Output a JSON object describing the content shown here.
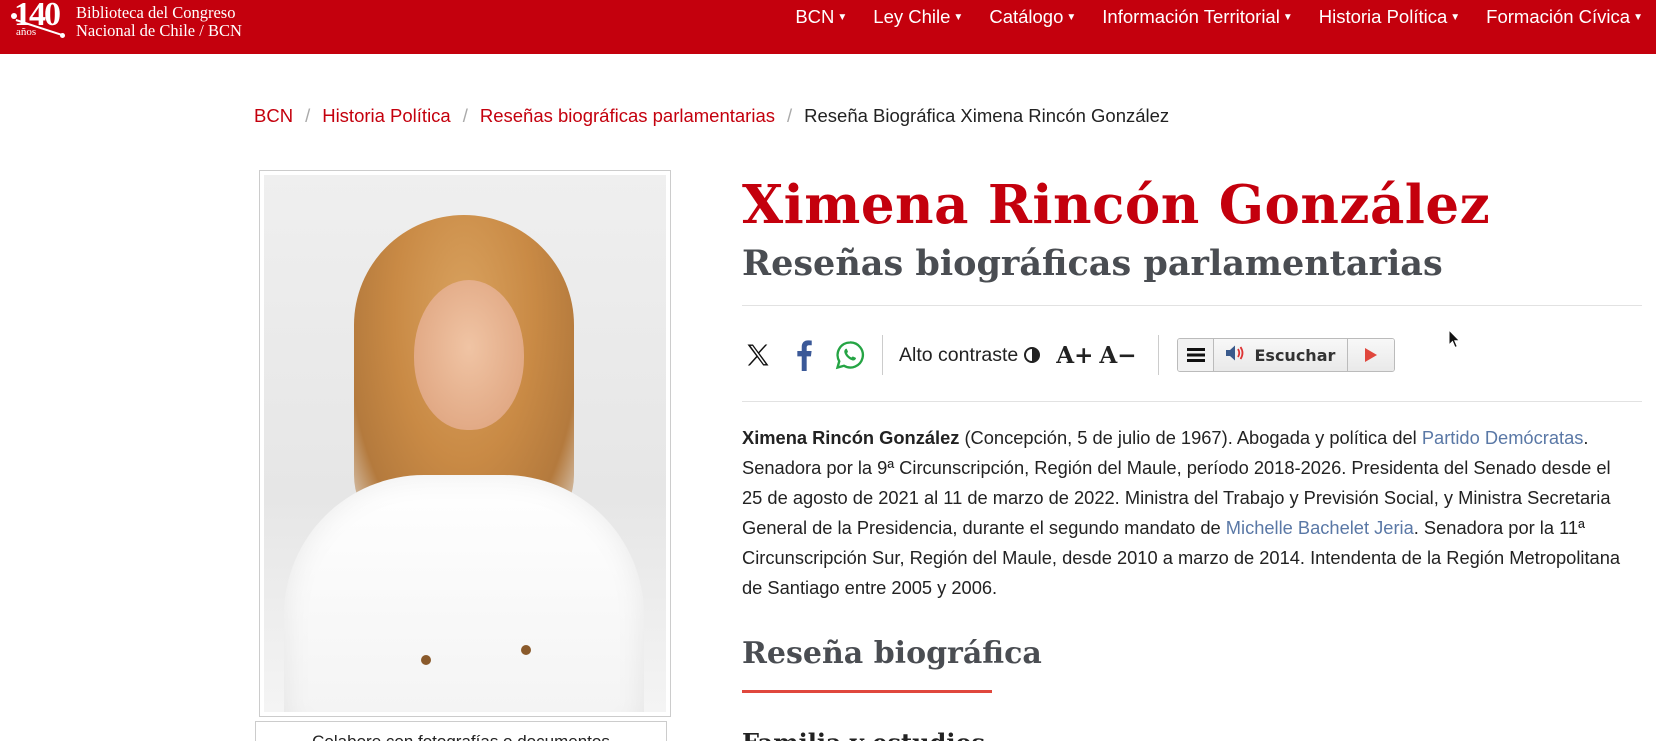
{
  "header": {
    "logo": {
      "number": "140",
      "suffix": "años",
      "line1": "Biblioteca del Congreso",
      "line2": "Nacional de Chile / BCN"
    },
    "nav": [
      {
        "label": "BCN"
      },
      {
        "label": "Ley Chile"
      },
      {
        "label": "Catálogo"
      },
      {
        "label": "Información Territorial"
      },
      {
        "label": "Historia Política"
      },
      {
        "label": "Formación Cívica"
      }
    ],
    "brand_color": "#c4000d"
  },
  "breadcrumb": {
    "items": [
      "BCN",
      "Historia Política",
      "Reseñas biográficas parlamentarias"
    ],
    "current": "Reseña Biográfica Ximena Rincón González",
    "separator": "/"
  },
  "photo": {
    "collab_text": "Colabore con fotografías o documentos"
  },
  "page": {
    "title": "Ximena Rincón González",
    "subtitle": "Reseñas biográficas parlamentarias"
  },
  "toolbar": {
    "share_icons": [
      "x-icon",
      "facebook-icon",
      "whatsapp-icon"
    ],
    "contrast_label": "Alto contraste",
    "font_increase": "A+",
    "font_decrease": "A−",
    "listen_label": "Escuchar"
  },
  "bio": {
    "name": "Ximena Rincón González",
    "p1": " (Concepción, 5 de julio de 1967). Abogada y política del ",
    "link1": "Partido Demócratas",
    "p2": ". Senadora por la 9ª Circunscripción, Región del Maule, período 2018-2026. Presidenta del Senado desde el 25 de agosto de 2021 al 11 de marzo de 2022. Ministra del Trabajo y Previsión Social, y Ministra Secretaria General de la Presidencia, durante el segundo mandato de ",
    "link2": "Michelle Bachelet Jeria",
    "p3": ". Senadora por la 11ª Circunscripción Sur, Región del Maule, desde 2010 a marzo de 2014. Intendenta de la Región Metropolitana de Santiago entre 2005 y 2006."
  },
  "sections": {
    "heading": "Reseña biográfica",
    "subheading": "Familia y estudios"
  }
}
